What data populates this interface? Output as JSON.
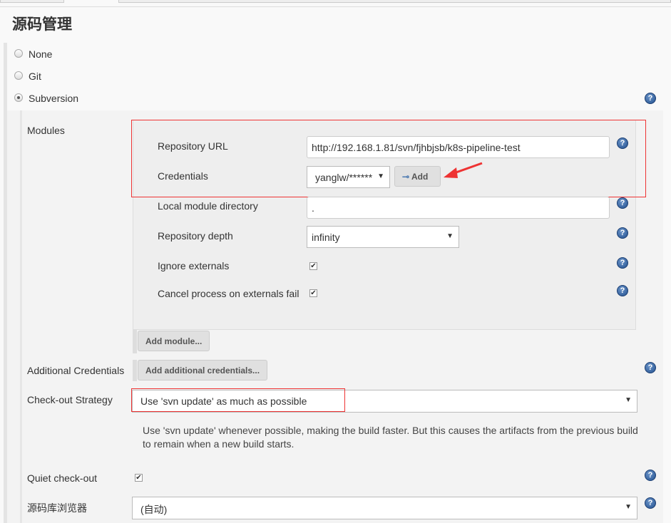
{
  "section_title": "源码管理",
  "scm_options": [
    {
      "label": "None",
      "selected": false
    },
    {
      "label": "Git",
      "selected": false
    },
    {
      "label": "Subversion",
      "selected": true
    }
  ],
  "modules": {
    "label": "Modules",
    "repository_url_label": "Repository URL",
    "repository_url": "http://192.168.1.81/svn/fjhbjsb/k8s-pipeline-test",
    "credentials_label": "Credentials",
    "credentials_value": "yanglw/******",
    "add_label": "Add",
    "local_dir_label": "Local module directory",
    "local_dir_value": ".",
    "depth_label": "Repository depth",
    "depth_value": "infinity",
    "ignore_externals_label": "Ignore externals",
    "ignore_externals": true,
    "cancel_externals_label": "Cancel process on externals fail",
    "cancel_externals": true,
    "add_module_label": "Add module..."
  },
  "additional_credentials": {
    "label": "Additional Credentials",
    "button": "Add additional credentials..."
  },
  "checkout": {
    "label": "Check-out Strategy",
    "value": "Use 'svn update' as much as possible",
    "description": "Use 'svn update' whenever possible, making the build faster. But this causes the artifacts from the previous build to remain when a new build starts."
  },
  "quiet": {
    "label": "Quiet check-out",
    "checked": true
  },
  "browser": {
    "label": "源码库浏览器",
    "value": "(自动)"
  },
  "annotation_color": "#ee3333"
}
